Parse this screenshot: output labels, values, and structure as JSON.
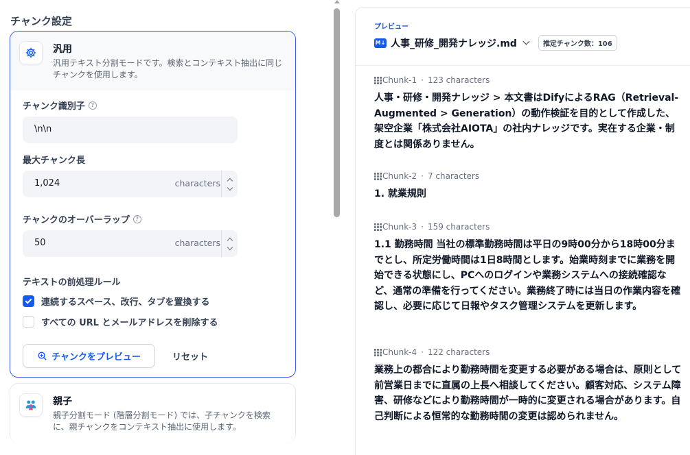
{
  "left": {
    "section_title": "チャンク設定",
    "general_mode": {
      "title": "汎用",
      "description": "汎用テキスト分割モードです。検索とコンテキスト抽出に同じチャンクを使用します。",
      "icon": "gear-icon"
    },
    "delimiter": {
      "label": "チャンク識別子",
      "value": "\\n\\n"
    },
    "max_length": {
      "label": "最大チャンク長",
      "value": "1,024",
      "unit": "characters"
    },
    "overlap": {
      "label": "チャンクのオーバーラップ",
      "value": "50",
      "unit": "characters"
    },
    "preprocess": {
      "label": "テキストの前処理ルール",
      "rules": [
        {
          "label": "連続するスペース、改行、タブを置換する",
          "checked": true
        },
        {
          "label": "すべての URL とメールアドレスを削除する",
          "checked": false
        }
      ]
    },
    "preview_button": "チャンクをプレビュー",
    "reset_button": "リセット",
    "parent_mode": {
      "title": "親子",
      "description": "親子分割モード (階層分割モード) では、子チャンクを検索に、親チャンクをコンテキスト抽出に使用します。",
      "icon": "parent-child-icon"
    }
  },
  "right": {
    "preview_label": "プレビュー",
    "file_icon": "M↓",
    "file_name": "人事_研修_開発ナレッジ.md",
    "chunk_count": "推定チャンク数：106",
    "chunks": [
      {
        "name": "Chunk-1",
        "chars": "123 characters",
        "text": "人事・研修・開発ナレッジ > 本文書はDifyによるRAG（Retrieval-Augmented > Generation）の動作検証を目的として作成した、架空企業「株式会社AIOTA」の社内ナレッジです。実在する企業・制度とは関係ありません。"
      },
      {
        "name": "Chunk-2",
        "chars": "7 characters",
        "text": "1. 就業規則"
      },
      {
        "name": "Chunk-3",
        "chars": "159 characters",
        "text": "1.1 勤務時間 当社の標準勤務時間は平日の9時00分から18時00分までとし、所定労働時間は1日8時間とします。始業時刻までに業務を開始できる状態にし、PCへのログインや業務システムへの接続確認など、通常の準備を行ってください。業務終了時には当日の作業内容を確認し、必要に応じて日報やタスク管理システムを更新します。"
      },
      {
        "name": "Chunk-4",
        "chars": "122 characters",
        "text": "業務上の都合により勤務時間を変更する必要がある場合は、原則として前営業日までに直属の上長へ相談してください。顧客対応、システム障害、研修などにより勤務時間が一時的に変更される場合があります。自己判断による恒常的な勤務時間の変更は認められません。"
      }
    ]
  },
  "colors": {
    "accent": "#155aef",
    "border_active": "#3f5be6"
  }
}
